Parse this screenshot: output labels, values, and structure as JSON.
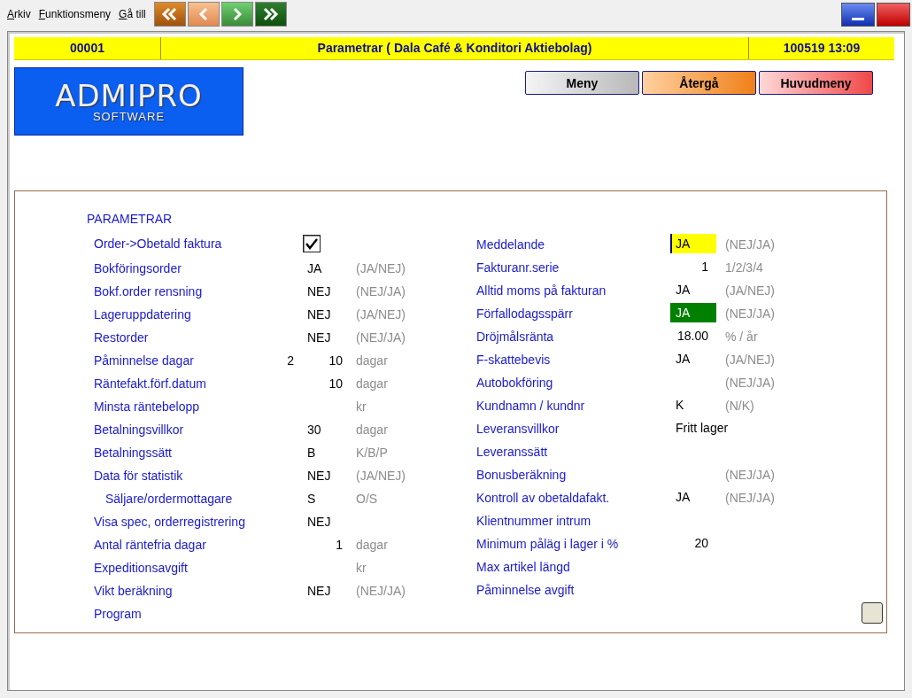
{
  "menu": [
    {
      "label": "Arkiv"
    },
    {
      "label": "Funktionsmeny"
    },
    {
      "label": "Gå till"
    }
  ],
  "nav_buttons": [
    {
      "kind": "first"
    },
    {
      "kind": "prev"
    },
    {
      "kind": "next"
    },
    {
      "kind": "last"
    }
  ],
  "window_buttons": [
    {
      "kind": "minimize"
    },
    {
      "kind": "close"
    }
  ],
  "header": {
    "number": "00001",
    "title": "Parametrar ( Dala Café & Konditori Aktiebolag)",
    "timestamp": "100519 13:09"
  },
  "logo": {
    "title": "ADMIPRO",
    "subtitle": "SOFTWARE"
  },
  "buttons": [
    {
      "label": "Meny",
      "kind": "menu"
    },
    {
      "label": "Återgå",
      "kind": "back"
    },
    {
      "label": "Huvudmeny",
      "kind": "main"
    }
  ],
  "panel": {
    "heading": "PARAMETRAR",
    "left_rows": [
      {
        "kind": "check",
        "label": "Order->Obetald faktura",
        "checked": true
      },
      {
        "kind": "text",
        "label": "Bokföringsorder",
        "value": "JA",
        "hint": "(JA/NEJ)"
      },
      {
        "kind": "text",
        "label": "Bokf.order rensning",
        "value": "NEJ",
        "hint": "(NEJ/JA)"
      },
      {
        "kind": "text",
        "label": "Lageruppdatering",
        "value": "NEJ",
        "hint": "(JA/NEJ)"
      },
      {
        "kind": "text",
        "label": "Restorder",
        "value": "NEJ",
        "hint": "(NEJ/JA)"
      },
      {
        "kind": "number",
        "label": "Påminnelse dagar",
        "pre": "2",
        "value": "10",
        "hint": "dagar"
      },
      {
        "kind": "number",
        "label": "Räntefakt.förf.datum",
        "value": "10",
        "hint": "dagar"
      },
      {
        "kind": "number",
        "label": "Minsta räntebelopp",
        "hint": "kr"
      },
      {
        "kind": "text",
        "label": "Betalningsvillkor",
        "value": "30",
        "hint": "dagar"
      },
      {
        "kind": "text",
        "label": "Betalningssätt",
        "value": "B",
        "hint": "K/B/P"
      },
      {
        "kind": "text",
        "label": "Data för statistik",
        "value": "NEJ",
        "hint": "(JA/NEJ)",
        "children": [
          {
            "kind": "text",
            "label": "Säljare/ordermottagare",
            "value": "S",
            "hint": "O/S"
          }
        ]
      },
      {
        "kind": "text",
        "label": "Visa spec, orderregistrering",
        "value": "NEJ"
      },
      {
        "kind": "number",
        "label": "Antal räntefria dagar",
        "value": "1",
        "hint": "dagar"
      },
      {
        "kind": "text",
        "label": "Expeditionsavgift",
        "hint": "kr"
      },
      {
        "kind": "text",
        "label": "Vikt beräkning",
        "value": "NEJ",
        "hint": "(NEJ/JA)"
      },
      {
        "kind": "text",
        "label": "Program"
      }
    ],
    "right_rows": [
      {
        "kind": "field",
        "label": "Meddelande",
        "value": "JA",
        "hint": "(NEJ/JA)",
        "color": "#ffff00",
        "focused": true
      },
      {
        "kind": "number",
        "label": "Fakturanr.serie",
        "value": "1",
        "hint": "1/2/3/4"
      },
      {
        "kind": "text",
        "label": "Alltid moms på fakturan",
        "value": "JA",
        "hint": "(JA/NEJ)"
      },
      {
        "kind": "field",
        "label": "Förfallodagsspärr",
        "value": "JA",
        "hint": "(NEJ/JA)",
        "color": "#008000",
        "focused": false
      },
      {
        "kind": "number",
        "label": "Dröjmålsränta",
        "value": "18.00",
        "hint": "% / år"
      },
      {
        "kind": "text",
        "label": "F-skattebevis",
        "value": "JA",
        "hint": "(JA/NEJ)"
      },
      {
        "kind": "text",
        "label": "Autobokföring",
        "hint": "(NEJ/JA)"
      },
      {
        "kind": "text",
        "label": "Kundnamn / kundnr",
        "value": "K",
        "hint": "(N/K)"
      },
      {
        "kind": "text",
        "label": "Leveransvillkor",
        "value": "Fritt lager"
      },
      {
        "kind": "text",
        "label": "Leveranssätt"
      },
      {
        "kind": "text",
        "label": "Bonusberäkning",
        "hint": "(NEJ/JA)"
      },
      {
        "kind": "text",
        "label": "Kontroll av obetaldafakt.",
        "value": "JA",
        "hint": "(NEJ/JA)"
      },
      {
        "kind": "text",
        "label": "Klientnummer intrum"
      },
      {
        "kind": "number",
        "label": "Minimum påläg i lager i %",
        "value": "20"
      },
      {
        "kind": "text",
        "label": "Max artikel längd"
      },
      {
        "kind": "text",
        "label": "Påminnelse avgift"
      }
    ]
  }
}
